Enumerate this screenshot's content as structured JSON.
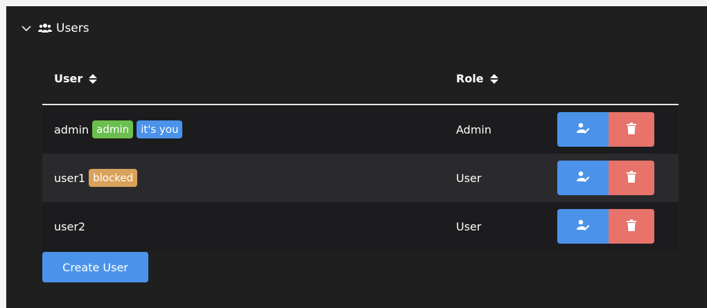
{
  "panel": {
    "title": "Users",
    "expanded": true
  },
  "table": {
    "headers": {
      "user": "User",
      "role": "Role"
    },
    "rows": [
      {
        "username": "admin",
        "badges": [
          {
            "text": "admin",
            "color": "#6bbf4e"
          },
          {
            "text": "it's you",
            "color": "#4b93ea"
          }
        ],
        "role": "Admin"
      },
      {
        "username": "user1",
        "badges": [
          {
            "text": "blocked",
            "color": "#d9a15a"
          }
        ],
        "role": "User"
      },
      {
        "username": "user2",
        "badges": [],
        "role": "User"
      }
    ]
  },
  "actions": {
    "edit_icon": "user-edit-icon",
    "delete_icon": "trash-icon",
    "edit_color": "#4b93ea",
    "delete_color": "#e7736b"
  },
  "create_button": {
    "label": "Create User"
  }
}
